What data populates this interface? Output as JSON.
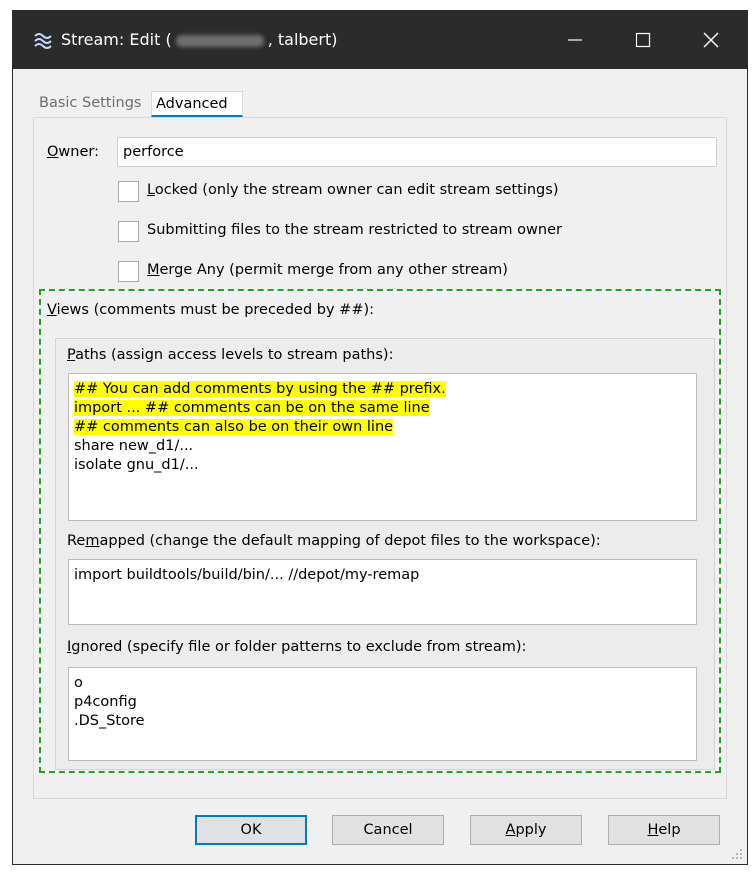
{
  "titlebar": {
    "title_prefix": "Stream: Edit (",
    "title_suffix": ", talbert)",
    "icon": "stream-icon",
    "background": "#2b2b2b"
  },
  "tabs": [
    {
      "label": "Basic Settings",
      "active": false
    },
    {
      "label": "Advanced",
      "active": true
    }
  ],
  "owner": {
    "label_first": "O",
    "label_rest": "wner:",
    "value": "perforce"
  },
  "checkboxes": [
    {
      "label_first": "L",
      "label_rest": "ocked (only the stream owner can edit stream settings)",
      "checked": false
    },
    {
      "label_first": "",
      "label_rest": "Submitting files to the stream restricted to stream owner",
      "checked": false
    },
    {
      "label_first": "M",
      "label_rest": "erge Any (permit merge from any other stream)",
      "checked": false
    }
  ],
  "views": {
    "label_first": "V",
    "label_rest": "iews (comments must be preceded by ##):",
    "highlight_color": "#22a322"
  },
  "paths": {
    "label_first": "P",
    "label_rest": "aths (assign access levels to stream paths):",
    "lines": [
      "## You can add comments by using the ## prefix.",
      "import ... ## comments can be on the same line",
      "## comments can also be on their own line",
      "share new_d1/...",
      "isolate gnu_d1/..."
    ],
    "highlight": "#ffff00"
  },
  "remapped": {
    "label_a": "Re",
    "label_u": "m",
    "label_rest": "apped (change the default mapping of depot files to the workspace):",
    "lines": [
      "import buildtools/build/bin/... //depot/my-remap"
    ]
  },
  "ignored": {
    "label_first": "I",
    "label_rest": "gnored (specify file or folder patterns to exclude from stream):",
    "lines": [
      "o",
      "p4config",
      ".DS_Store"
    ]
  },
  "buttons": {
    "ok": "OK",
    "cancel": "Cancel",
    "apply_first": "A",
    "apply_rest": "pply",
    "help_first": "H",
    "help_rest": "elp"
  },
  "colors": {
    "accent": "#0078d7"
  }
}
